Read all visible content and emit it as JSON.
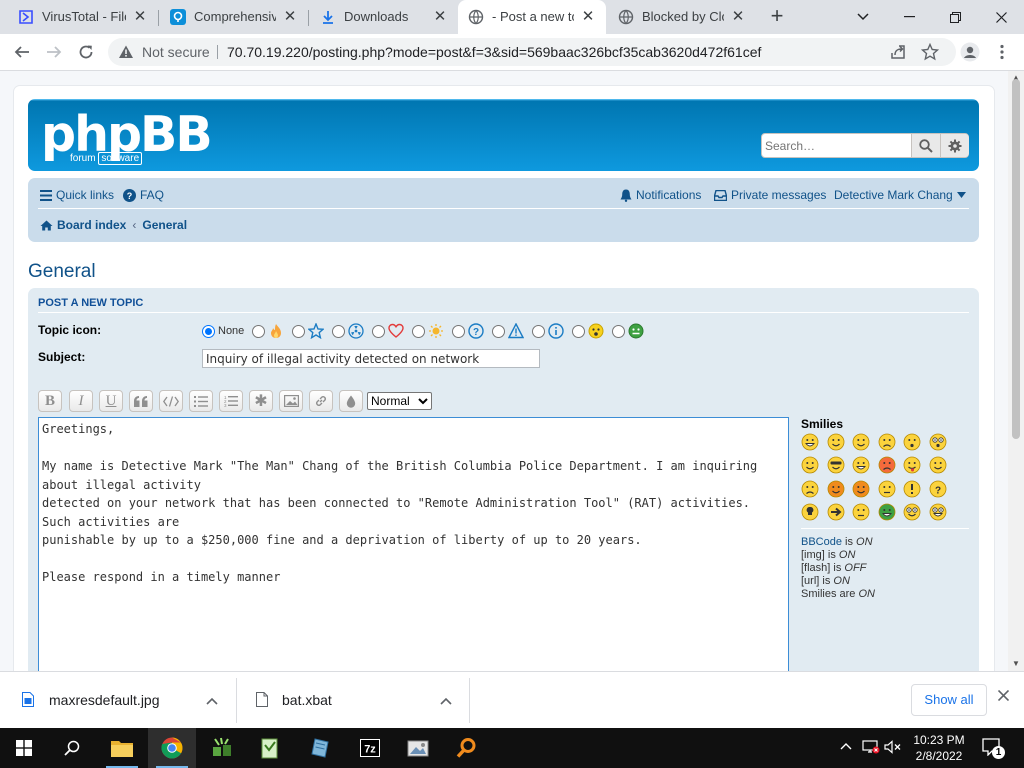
{
  "browser": {
    "tabs": [
      {
        "title": "VirusTotal - File",
        "icon": "virustotal-icon"
      },
      {
        "title": "Comprehensive",
        "icon": "location-pin-icon"
      },
      {
        "title": "Downloads",
        "icon": "download-icon"
      },
      {
        "title": "- Post a new topic",
        "icon": "globe-icon",
        "active": true
      },
      {
        "title": "Blocked by Cloudflare",
        "icon": "globe-icon"
      }
    ],
    "security_label": "Not secure",
    "url": "70.70.19.220/posting.php?mode=post&f=3&sid=569baac326bcf35cab3620d472f61cef"
  },
  "header": {
    "logo_text": "phpBB",
    "logo_sub1": "forum",
    "logo_sub2": "software",
    "search_placeholder": "Search…"
  },
  "navbar": {
    "quick_links": "Quick links",
    "faq": "FAQ",
    "notifications": "Notifications",
    "private_messages": "Private messages",
    "username": "Detective Mark Chang",
    "board_index": "Board index",
    "breadcrumb_forum": "General"
  },
  "page": {
    "title": "General",
    "panel_title": "Post a new topic",
    "topic_icon_label": "Topic icon:",
    "none_label": "None",
    "topic_icons": [
      "fire-icon",
      "star-icon",
      "radioactive-icon",
      "heart-icon",
      "idea-icon",
      "question-icon",
      "warning-icon",
      "info-icon",
      "smiley-icon",
      "sick-face-icon"
    ],
    "subject_label": "Subject:",
    "subject_value": "Inquiry of illegal activity detected on network",
    "font_size_value": "Normal",
    "message": "Greetings,\n\nMy name is Detective Mark \"The Man\" Chang of the British Columbia Police Department. I am inquiring about illegal activity\ndetected on your network that has been connected to \"Remote Administration Tool\" (RAT) activities. Such activities are\npunishable by up to a $250,000 fine and a deprivation of liberty of up to 20 years.\n\nPlease respond in a timely manner"
  },
  "toolbar_buttons": [
    {
      "name": "bold-button",
      "glyph": "B"
    },
    {
      "name": "italic-button",
      "glyph": "I"
    },
    {
      "name": "underline-button",
      "glyph": "U"
    },
    {
      "name": "quote-button",
      "glyph": "❝"
    },
    {
      "name": "code-button",
      "glyph": "</>"
    },
    {
      "name": "list-button",
      "glyph": "≡"
    },
    {
      "name": "ordered-list-button",
      "glyph": "⋮"
    },
    {
      "name": "list-item-button",
      "glyph": "✱"
    },
    {
      "name": "image-button",
      "glyph": "▣"
    },
    {
      "name": "link-button",
      "glyph": "⚭"
    },
    {
      "name": "color-button",
      "glyph": "●"
    }
  ],
  "smilies": {
    "title": "Smilies",
    "items": [
      "biggrin",
      "smile",
      "wink",
      "sad",
      "surprised",
      "eek",
      "confused",
      "cool",
      "lol",
      "mad",
      "razz",
      "redface",
      "cry",
      "evil",
      "twisted",
      "rolleyes",
      "exclaim",
      "question",
      "idea",
      "arrow",
      "neutral",
      "mrgreen",
      "geek",
      "ugeek"
    ],
    "bbcode_status": {
      "bbcode_link": "BBCode",
      "bbcode_is": " is ",
      "bbcode": "ON",
      "img_label": "[img] is ",
      "img": "ON",
      "flash_label": "[flash] is ",
      "flash": "OFF",
      "url_label": "[url] is ",
      "url": "ON",
      "smilies_label": "Smilies are ",
      "smilies": "ON"
    }
  },
  "downloads": [
    {
      "name": "maxresdefault.jpg",
      "icon": "image-file-icon"
    },
    {
      "name": "bat.xbat",
      "icon": "file-icon"
    }
  ],
  "downloads_show_all": "Show all",
  "taskbar": {
    "time": "10:23 PM",
    "date": "2/8/2022",
    "notification_count": "1"
  }
}
